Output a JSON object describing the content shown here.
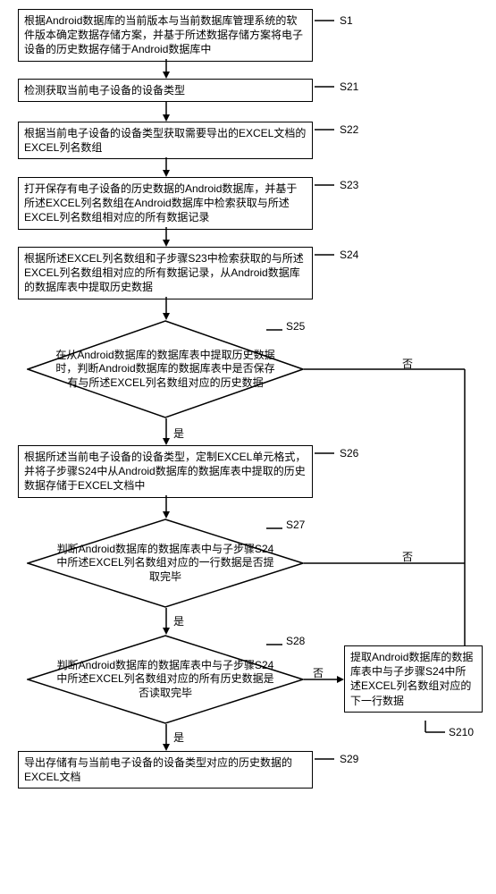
{
  "steps": {
    "s1": {
      "label": "S1",
      "text": "根据Android数据库的当前版本与当前数据库管理系统的软件版本确定数据存储方案，并基于所述数据存储方案将电子设备的历史数据存储于Android数据库中"
    },
    "s21": {
      "label": "S21",
      "text": "检测获取当前电子设备的设备类型"
    },
    "s22": {
      "label": "S22",
      "text": "根据当前电子设备的设备类型获取需要导出的EXCEL文档的EXCEL列名数组"
    },
    "s23": {
      "label": "S23",
      "text": "打开保存有电子设备的历史数据的Android数据库，并基于所述EXCEL列名数组在Android数据库中检索获取与所述EXCEL列名数组相对应的所有数据记录"
    },
    "s24": {
      "label": "S24",
      "text": "根据所述EXCEL列名数组和子步骤S23中检索获取的与所述EXCEL列名数组相对应的所有数据记录，从Android数据库的数据库表中提取历史数据"
    },
    "s25": {
      "label": "S25",
      "text": "在从Android数据库的数据库表中提取历史数据时，判断Android数据库的数据库表中是否保存有与所述EXCEL列名数组对应的历史数据"
    },
    "s26": {
      "label": "S26",
      "text": "根据所述当前电子设备的设备类型，定制EXCEL单元格式，并将子步骤S24中从Android数据库的数据库表中提取的历史数据存储于EXCEL文档中"
    },
    "s27": {
      "label": "S27",
      "text": "判断Android数据库的数据库表中与子步骤S24中所述EXCEL列名数组对应的一行数据是否提取完毕"
    },
    "s28": {
      "label": "S28",
      "text": "判断Android数据库的数据库表中与子步骤S24中所述EXCEL列名数组对应的所有历史数据是否读取完毕"
    },
    "s29": {
      "label": "S29",
      "text": "导出存储有与当前电子设备的设备类型对应的历史数据的EXCEL文档"
    },
    "s210": {
      "label": "S210",
      "text": "提取Android数据库的数据库表中与子步骤S24中所述EXCEL列名数组对应的下一行数据"
    }
  },
  "branches": {
    "yes": "是",
    "no": "否"
  }
}
